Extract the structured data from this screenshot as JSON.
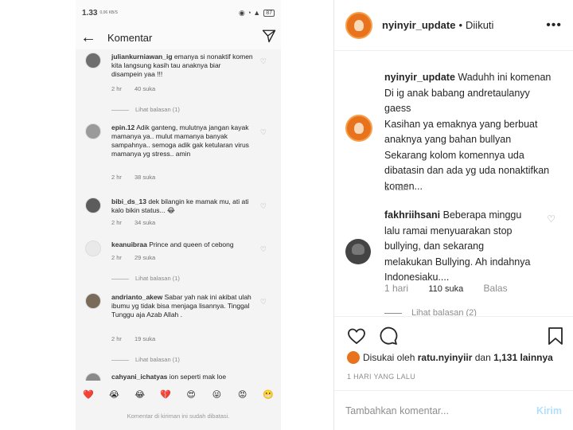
{
  "phone": {
    "status": {
      "time": "1.33",
      "network": "0,06 KB/S",
      "battery": "87"
    },
    "title": "Komentar",
    "comments": [
      {
        "user": "juliankurniawan_ig",
        "text": "emanya si nonaktif komen kita langsung kasih tau anaknya biar disampein yaa !!!",
        "time": "2 hr",
        "likes": "40 suka",
        "replies": "Lihat balasan (1)"
      },
      {
        "user": "epin.12",
        "text": "Adik ganteng, mulutnya jangan kayak mamanya ya.. mulut mamanya banyak sampahnya.. semoga adik gak ketularan virus mamanya yg stress.. amin",
        "time": "2 hr",
        "likes": "38 suka",
        "replies": ""
      },
      {
        "user": "bibi_ds_13",
        "text": "dek bilangin ke mamak mu, ati ati kalo bikin status... 😂",
        "time": "2 hr",
        "likes": "34 suka",
        "replies": ""
      },
      {
        "user": "keanuibraa",
        "text": "Prince and queen of cebong",
        "time": "2 hr",
        "likes": "29 suka",
        "replies": "Lihat balasan (1)"
      },
      {
        "user": "andrianto_akew",
        "text": "Sabar yah nak ini akibat ulah ibumu yg tidak bisa menjaga lisannya.  Tinggal Tunggu aja Azab Allah .",
        "time": "2 hr",
        "likes": "19 suka",
        "replies": "Lihat balasan (1)"
      },
      {
        "user": "cahyani_ichatyas",
        "text": "ion seperti mak loe",
        "time": "",
        "likes": "",
        "replies": ""
      }
    ],
    "emojis": [
      "❤️",
      "😭",
      "😂",
      "💔",
      "😍",
      "😜",
      "😡",
      "😬"
    ],
    "disabled_notice": "Komentar di kiriman ini sudah dibatasi."
  },
  "post": {
    "username": "nyinyir_update",
    "separator": "•",
    "follow_status": "Diikuti",
    "caption_user": "nyinyir_update",
    "caption_text": " Waduhh ini komenan\nDi ig anak babang andretaulanyy\ngaess\nKasihan ya emaknya yang berbuat\nanaknya yang bahan bullyan\nSekarang kolom komennya uda\ndibatasin dan ada yg uda nonaktifkan\nkomen...",
    "caption_time": "1 hari",
    "comment": {
      "user": "fakhriihsani",
      "text": " Beberapa minggu\nlalu ramai menyuarakan stop\nbullying, dan sekarang\nmelakukan Bullying. Ah indahnya\nIndonesiaku....",
      "time": "1 hari",
      "likes": "110 suka",
      "reply": "Balas",
      "view_replies": "Lihat balasan (2)"
    },
    "liked_prefix": "Disukai oleh",
    "liked_user": "ratu.nyinyiir",
    "liked_and": "dan",
    "liked_count": "1,131 lainnya",
    "posted_ago": "1 HARI YANG LALU",
    "add_comment_placeholder": "Tambahkan komentar...",
    "post_button": "Kirim"
  }
}
